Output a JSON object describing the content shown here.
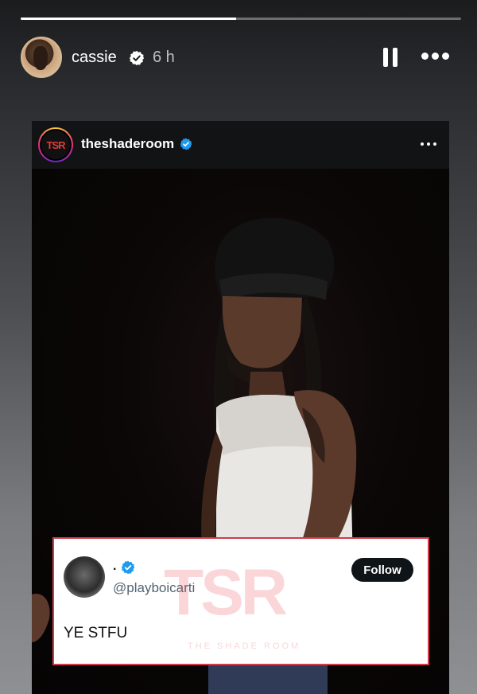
{
  "story": {
    "progress": 0.49,
    "username": "cassie",
    "time": "6 h"
  },
  "post": {
    "username": "theshaderoom",
    "avatar_text": "TSR"
  },
  "tweet": {
    "display_name": ".",
    "handle": "@playboicarti",
    "follow_label": "Follow",
    "text": "YE STFU"
  },
  "watermark": {
    "logo": "TSR",
    "text": "THE SHADE ROOM"
  },
  "colors": {
    "verified_white": "#ffffff",
    "verified_blue": "#1d9bf0",
    "tweet_border": "#d33a4a"
  },
  "icons": [
    "verified-badge-icon",
    "pause-icon",
    "more-options-icon"
  ]
}
